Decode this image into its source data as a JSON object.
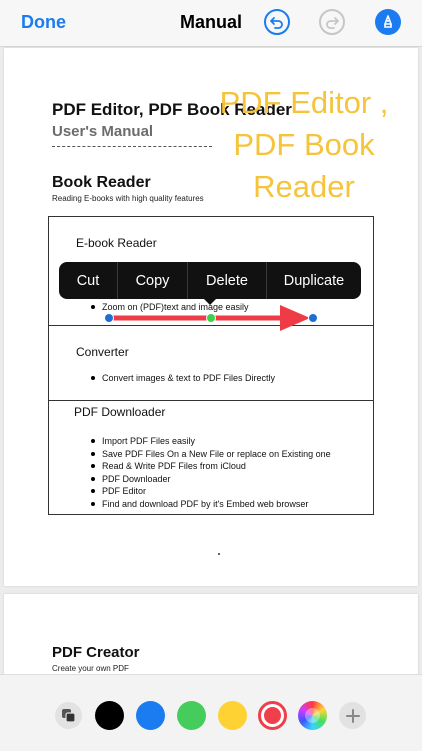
{
  "nav": {
    "done_label": "Done",
    "title": "Manual",
    "icons": [
      "undo-icon",
      "redo-icon",
      "markup-pen-icon"
    ]
  },
  "page1": {
    "title": "PDF Editor, PDF Book Reader",
    "subtitle": "User's Manual",
    "section_heading": "Book Reader",
    "section_desc": "Reading E-books with high quality features",
    "table": {
      "rows": [
        {
          "title": "E-book Reader",
          "items": [
            "Zoom on (PDF)text and image easily"
          ]
        },
        {
          "title": "Converter",
          "items": [
            "Convert images & text to PDF Files Directly"
          ]
        },
        {
          "title": "PDF Downloader",
          "items": [
            "Import PDF Files easily",
            "Save PDF Files On a New File or replace on Existing one",
            "Read & Write PDF Files from iCloud",
            "PDF Downloader",
            "PDF Editor",
            "Find and download PDF by it's Embed web browser"
          ]
        }
      ]
    }
  },
  "annotation": {
    "lines": [
      "PDF Editor ,",
      "PDF Book",
      "Reader"
    ],
    "color": "#f5c43a"
  },
  "arrow": {
    "color": "#ee3b45",
    "handle_color": "#1f6fd0",
    "mid_handle_color": "#3bd14b"
  },
  "context_menu": {
    "items": [
      "Cut",
      "Copy",
      "Delete",
      "Duplicate"
    ]
  },
  "page2": {
    "heading": "PDF Creator",
    "desc": "Create your own PDF"
  },
  "palette": {
    "tools": [
      "layers-icon",
      "add-icon"
    ],
    "colors": [
      {
        "name": "black",
        "hex": "#000000"
      },
      {
        "name": "blue",
        "hex": "#1a7cf0"
      },
      {
        "name": "green",
        "hex": "#45cc5b"
      },
      {
        "name": "yellow",
        "hex": "#ffd234"
      },
      {
        "name": "red",
        "hex": "#ef3f4a",
        "selected": true
      },
      {
        "name": "color-picker",
        "hex": "multicolor"
      }
    ]
  }
}
